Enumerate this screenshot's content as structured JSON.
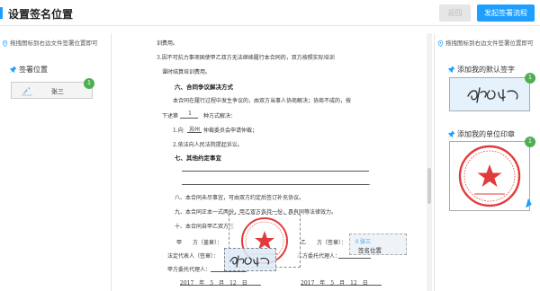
{
  "header": {
    "title": "设置签名位置",
    "back_label": "返回",
    "submit_label": "发起签署流程"
  },
  "left": {
    "hint": "拖拽图标到右边文件签署位置即可",
    "section": "签署位置",
    "signer_name": "张三",
    "signer_count": "1"
  },
  "right": {
    "hint": "拖拽图标到右边文件签署位置即可",
    "default_sig_label": "添加我的默认签字",
    "seal_label": "添加我的单位印章",
    "sig_count": "1",
    "seal_count": "1",
    "seal_text": "苏州优卡兰企业管理咨询有限公司"
  },
  "doc": {
    "l1": "训费用。",
    "l2": "3.因不可抗力事项固使甲乙双方无法继续履行本合同的，双方按照实际培训",
    "l3": "课时结算培训费用。",
    "h6": "六、合同争议解决方式",
    "l4": "本合同在履行过程中发生争议的，由双方当事人协商解决；协商不成的，按",
    "l5a": "下述第",
    "l5b": "1",
    "l5c": "种方式解决：",
    "l6a": "1.向",
    "l6b": "苏州",
    "l6c": "仲裁委员会申请仲裁；",
    "l7": "2.依法向人民法院提起诉讼。",
    "h7": "七、其他约定事宜",
    "l8": "八、本合同未尽事宜，可由双方约定后签订补充协议。",
    "l9": "九、本合同正本一式两份，甲乙双方各持一份，具有同等法律效力。",
    "l10": "十、本合同自甲乙双方签",
    "partyA": "甲　　方（盖章）：",
    "partyB": "乙　　方（签章）：",
    "legalA": "法定代表人（签章）：",
    "agentB": "乙方委托代理人：",
    "agentA": "甲方委托代理人：",
    "dateA": "2017　年　5　月　12　日",
    "dateB": "2017　年　5　月　12　日",
    "placed_name": "0 张三",
    "placed_label": "签名位置"
  }
}
